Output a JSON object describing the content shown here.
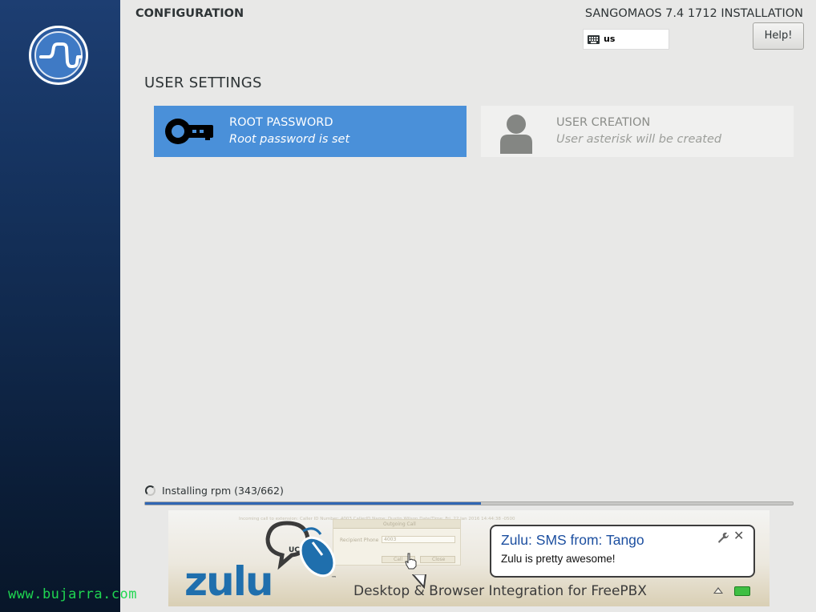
{
  "header": {
    "section": "CONFIGURATION",
    "product": "SANGOMAOS 7.4 1712 INSTALLATION",
    "keyboard_layout": "us",
    "help_label": "Help!"
  },
  "user_settings": {
    "title": "USER SETTINGS",
    "spokes": [
      {
        "title": "ROOT PASSWORD",
        "status": "Root password is set",
        "icon": "key-icon",
        "selected": true
      },
      {
        "title": "USER CREATION",
        "status": "User asterisk will be created",
        "icon": "user-icon",
        "selected": false
      }
    ]
  },
  "progress": {
    "text": "Installing rpm (343/662)",
    "fraction": 0.518
  },
  "banner": {
    "brand": "zulu",
    "brand_suffix": "UC",
    "trademark": "™",
    "tagline": "Desktop & Browser Integration for FreePBX",
    "notification": {
      "title": "Zulu: SMS from: Tango",
      "body": "Zulu is pretty awesome!",
      "close": "✕"
    },
    "screenshot": {
      "window_title": "Outgoing Call",
      "field_label": "Recipient Phone",
      "field_value": "4003",
      "button_call": "Call",
      "button_close": "Close",
      "caption": "Incoming call to extension: Caller ID Number: 4003 CallerID Name: Dustin Wilson Date/Time: Fri, 22 Jan 2016 14:44:38 -0500"
    }
  },
  "watermark": "www.bujarra.com",
  "colors": {
    "accent": "#4a90d9",
    "progress": "#2f66b4",
    "watermark": "#1fd651",
    "zulu_blue": "#1f6fad"
  }
}
